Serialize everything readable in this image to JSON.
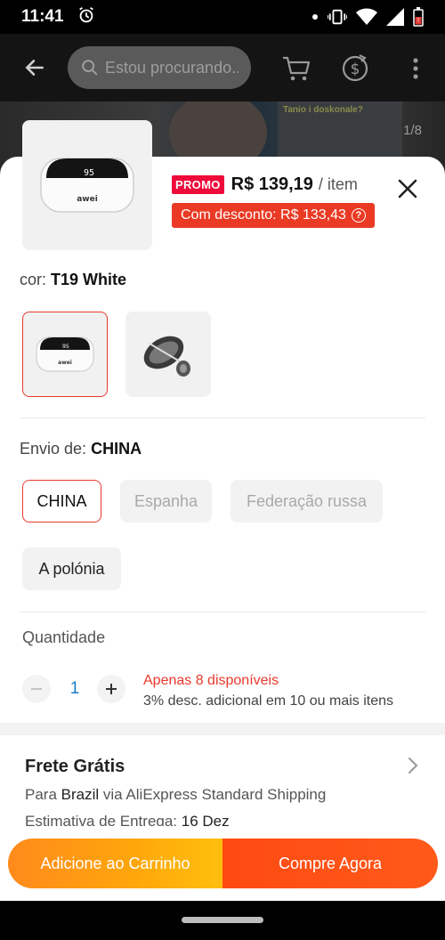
{
  "status_bar": {
    "time": "11:41"
  },
  "header": {
    "search_placeholder": "Estou procurando...",
    "page_counter": "1/8",
    "banner_text": "Tanio i doskonale?"
  },
  "product": {
    "promo_label": "PROMO",
    "price": "R$ 139,19",
    "per_unit": "/ item",
    "discount_text": "Com desconto: R$ 133,43",
    "device_brand": "awei",
    "device_display": "95"
  },
  "color": {
    "label": "cor:",
    "value": "T19 White"
  },
  "shipping": {
    "label": "Envio de:",
    "value": "CHINA",
    "options": [
      "CHINA",
      "Espanha",
      "Federação russa",
      "A polónia"
    ]
  },
  "quantity": {
    "label": "Quantidade",
    "value": "1",
    "stock": "Apenas 8 disponíveis",
    "bulk": "3% desc. adicional em 10 ou mais itens"
  },
  "freight": {
    "title": "Frete Grátis",
    "prefix": "Para",
    "country": "Brazil",
    "method": "via AliExpress Standard Shipping",
    "eta_label": "Estimativa de Entrega:",
    "eta_value": "16 Dez"
  },
  "actions": {
    "add_to_cart": "Adicione ao Carrinho",
    "buy_now": "Compre Agora"
  },
  "colors": {
    "accent": "#e8392c",
    "promo": "#ee0a3a",
    "cart_orange": "#ffa70a",
    "buy_red": "#ff4a12"
  }
}
